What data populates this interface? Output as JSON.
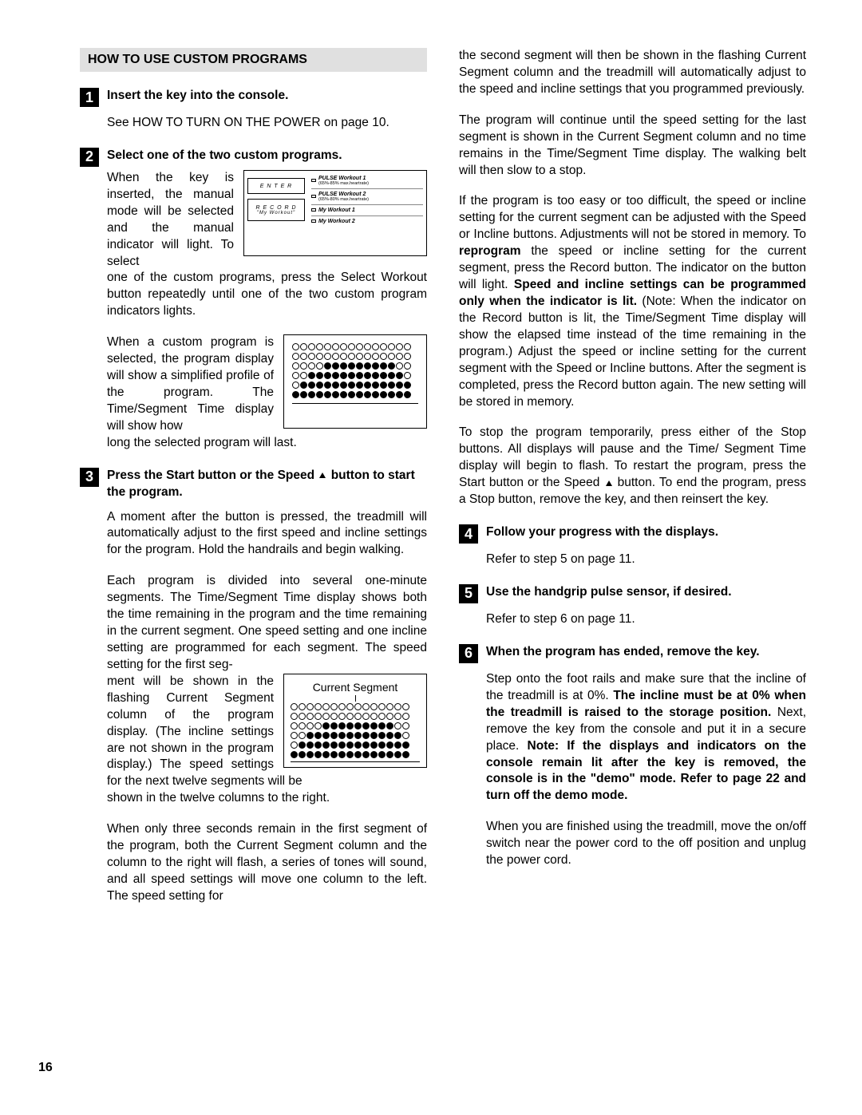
{
  "section_header": "HOW TO USE CUSTOM PROGRAMS",
  "page_number": "16",
  "step1": {
    "num": "1",
    "title": "Insert the key into the console.",
    "body": "See HOW TO TURN ON THE POWER on page 10."
  },
  "step2": {
    "num": "2",
    "title": "Select one of the two custom programs.",
    "para1": "When the key is inserted, the manual mode will be selected and the manual indicator will light. To select one of the custom programs, press the Select Workout button repeatedly until one of the two custom program indicators lights.",
    "para1a": "When the key is inserted, the manual mode will be selected and the manual indicator will light. To select",
    "para1b": "one of the custom programs, press the Select Workout button repeatedly until one of the two custom program indicators lights.",
    "para2a": "When a custom program is selected, the program display will show a simplified profile of the program. The Time/Segment Time display will show how",
    "para2b": "long the selected program will last.",
    "panel": {
      "enter": "E N T E R",
      "record": "R E C O R D",
      "myworkout": "\"My Workout\"",
      "pulse1": "PULSE Workout 1",
      "pulse1sub": "(65%-85% max.heartrate)",
      "pulse2": "PULSE Workout 2",
      "pulse2sub": "(65%-80% max.heartrate)",
      "mw1": "My Workout 1",
      "mw2": "My Workout 2"
    }
  },
  "step3": {
    "num": "3",
    "title_a": "Press the Start button or the Speed ",
    "title_b": " button to start the program.",
    "para1": "A moment after the button is pressed, the treadmill will automatically adjust to the first speed and incline settings for the program. Hold the handrails and begin walking.",
    "para2a": "Each program is divided into several one-minute segments. The Time/Segment Time display shows both the time remaining in the program and the time remaining in the current segment. One speed setting and one incline setting are programmed for each segment. The speed setting for the first segment will be shown in the flashing Current Segment column of the program display. (The incline settings are not shown in the program display.) The speed settings for the next twelve segments will be",
    "para2b": "shown in the twelve columns to the right.",
    "para2_pre": "Each program is divided into several one-minute segments. The Time/Segment Time display shows both the time remaining in the program and the time remaining in the current segment. One speed setting and one incline setting are programmed for each segment. The speed setting for the first seg-",
    "para2_float": "ment will be shown in the flashing Current Segment column of the program display. (The incline settings are not shown in the program display.) The speed settings for the next twelve segments will be",
    "cs_label": "Current Segment",
    "para3": "When only three seconds remain in the first segment of the program, both the Current Segment column and the column to the right will flash, a series of tones will sound, and all speed settings will move one column to the left. The speed setting for"
  },
  "col2": {
    "cont1": "the second segment will then be shown in the flashing Current Segment column and the treadmill will automatically adjust to the speed and incline settings that you programmed previously.",
    "para2": "The program will continue until the speed setting for the last segment is shown in the Current Segment column and no time remains in the Time/Segment Time display. The walking belt will then slow to a stop.",
    "para3a": "If the program is too easy or too difficult, the speed or incline setting for the current segment can be adjusted with the Speed or Incline buttons. Adjustments will not be stored in memory. To ",
    "para3b": "reprogram",
    "para3c": " the speed or incline setting for the current segment, press the Record button. The indicator on the button will light. ",
    "para3d": "Speed and incline settings can be programmed only when the indicator is lit.",
    "para3e": " (Note: When the indicator on the Record button is lit, the Time/Segment Time display will show the elapsed time instead of the time remaining in the program.) Adjust the speed or incline setting for the current segment with the Speed or Incline buttons. After the segment is completed, press the Record button again. The new setting will be stored in memory.",
    "para4a": "To stop the program temporarily, press either of the Stop buttons. All displays will pause and the Time/ Segment Time display will begin to flash. To restart the program, press the Start button or the Speed ",
    "para4b": " button. To end the program, press a Stop button, remove the key, and then reinsert the key."
  },
  "step4": {
    "num": "4",
    "title": "Follow your progress with the displays.",
    "body": "Refer to step 5 on page 11."
  },
  "step5": {
    "num": "5",
    "title": "Use the handgrip pulse sensor, if desired.",
    "body": "Refer to step 6 on page 11."
  },
  "step6": {
    "num": "6",
    "title": "When the program has ended, remove the key.",
    "para1a": "Step onto the foot rails and make sure that the incline of the treadmill is at 0%. ",
    "para1b": "The incline must be at 0% when the treadmill is raised to the storage position.",
    "para1c": " Next, remove the key from the console and put it in a secure place. ",
    "para1d": "Note: If the displays and indicators on the console remain lit after the key is removed, the console is in the \"demo\" mode. Refer to page 22 and turn off the demo mode.",
    "para2": "When you are finished using the treadmill, move the on/off switch near the power cord to the off position and unplug the power cord."
  }
}
